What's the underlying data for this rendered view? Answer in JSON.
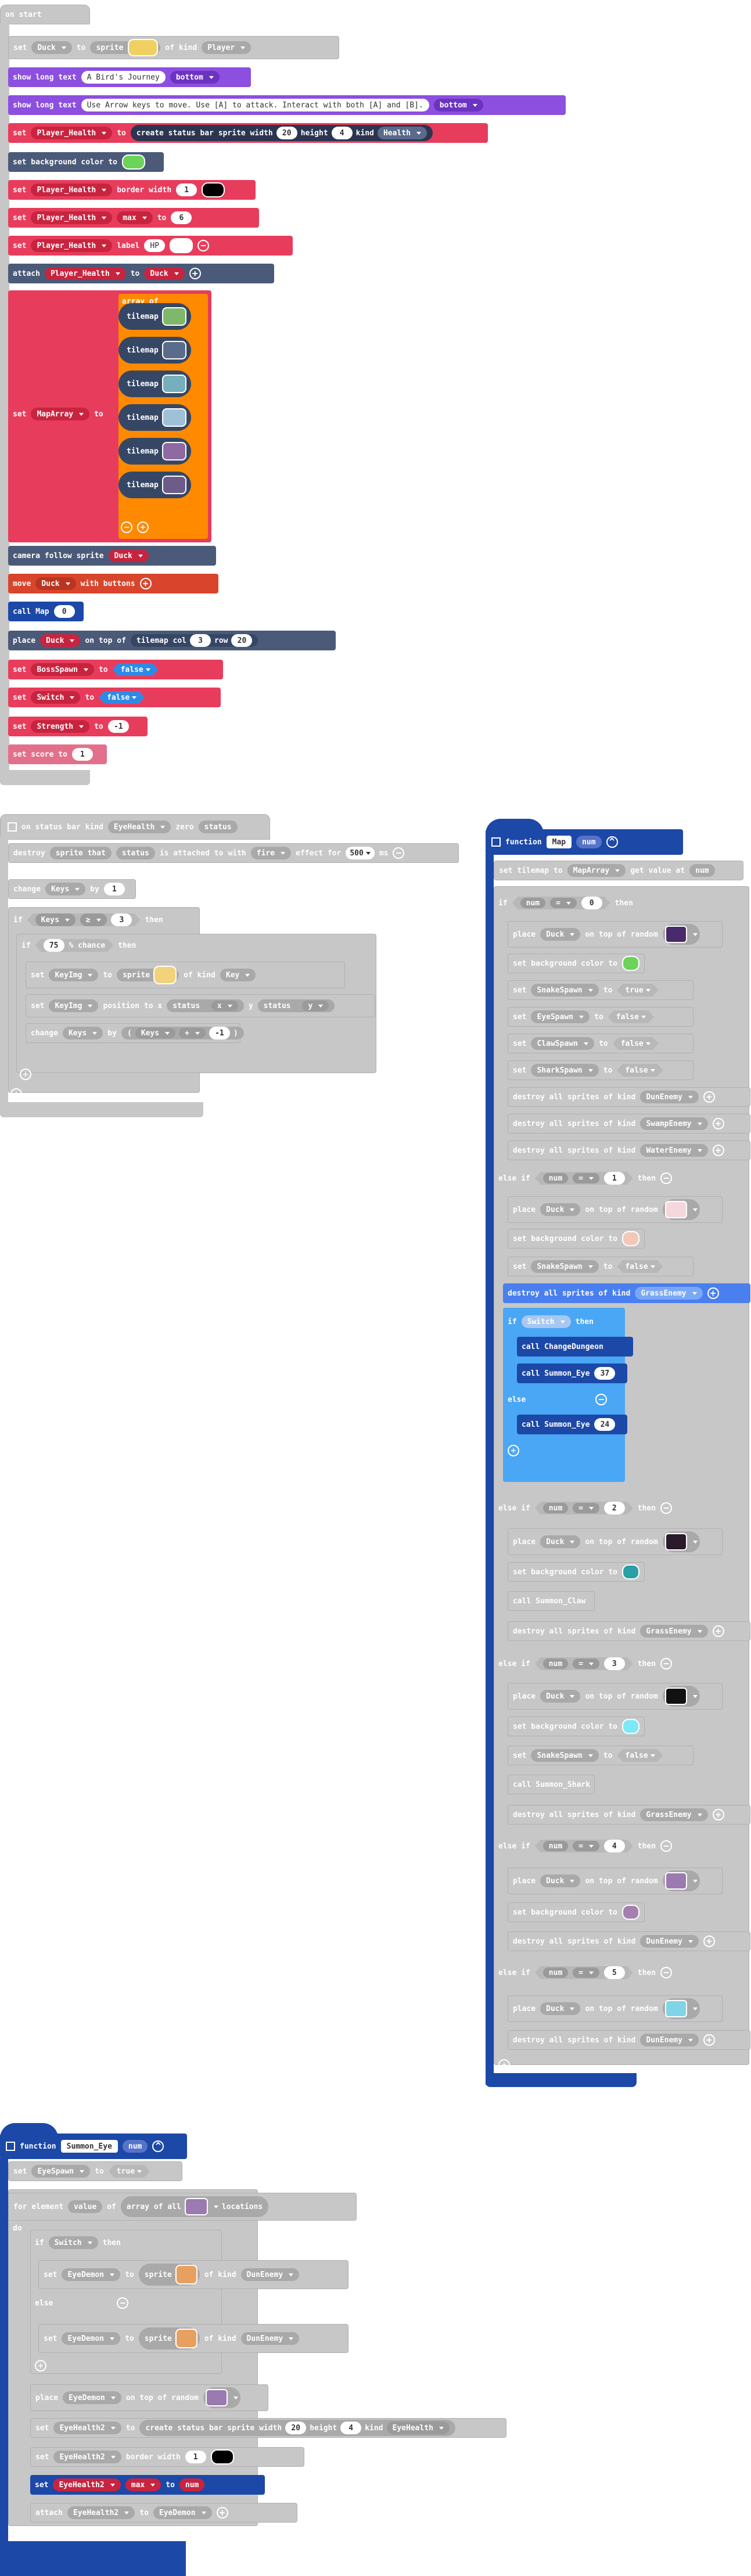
{
  "on_start": {
    "header": "on start",
    "rows": {
      "r1": {
        "set": "set",
        "var": "Duck",
        "to": "to",
        "sprite": "sprite",
        "ofkind": "of kind",
        "kind": "Player"
      },
      "r2": {
        "label": "show long text",
        "text": "A Bird's Journey",
        "pos": "bottom"
      },
      "r3": {
        "label": "show long text",
        "text": "Use Arrow keys to move. Use [A] to attack.  Interact with both [A] and [B].",
        "pos": "bottom"
      },
      "r4": {
        "set": "set",
        "var": "Player_Health",
        "to": "to",
        "create": "create status bar sprite width",
        "width": "20",
        "height_label": "height",
        "height": "4",
        "kind_label": "kind",
        "kind": "Health"
      },
      "r5": {
        "label": "set background color to"
      },
      "r6": {
        "set": "set",
        "var": "Player_Health",
        "prop": "border width",
        "val": "1"
      },
      "r7": {
        "set": "set",
        "var": "Player_Health",
        "prop": "max",
        "to": "to",
        "val": "6"
      },
      "r8": {
        "set": "set",
        "var": "Player_Health",
        "prop": "label",
        "val": "HP"
      },
      "r9": {
        "attach": "attach",
        "var": "Player_Health",
        "to": "to",
        "target": "Duck"
      },
      "r10": {
        "set": "set",
        "var": "MapArray",
        "to": "to",
        "array_of": "array of",
        "tilemap": "tilemap"
      },
      "r11": {
        "label": "camera follow sprite",
        "var": "Duck"
      },
      "r12": {
        "move": "move",
        "var": "Duck",
        "with": "with buttons"
      },
      "r13": {
        "call": "call Map",
        "arg": "0"
      },
      "r14": {
        "place": "place",
        "var": "Duck",
        "ontop": "on top of",
        "tile": "tilemap col",
        "col": "3",
        "row_label": "row",
        "row": "20"
      },
      "r15": {
        "set": "set",
        "var": "BossSpawn",
        "to": "to",
        "val": "false"
      },
      "r16": {
        "set": "set",
        "var": "Switch",
        "to": "to",
        "val": "false"
      },
      "r17": {
        "set": "set",
        "var": "Strength",
        "to": "to",
        "val": "-1"
      },
      "r18": {
        "label": "set score to",
        "val": "1"
      }
    }
  },
  "status_event": {
    "header": "on status bar kind",
    "kind": "EyeHealth",
    "zero": "zero",
    "status": "status",
    "destroy": "destroy",
    "sprite_that": "sprite that",
    "is_attached": "is attached to",
    "with": "with",
    "effect": "fire",
    "effect_for": "effect for",
    "ms": "500",
    "ms_unit": "ms",
    "change_keys": "change",
    "keys": "Keys",
    "by": "by",
    "by_val": "1",
    "if": "if",
    "op": "≥",
    "cmp": "3",
    "then": "then",
    "chance_val": "75",
    "chance": "% chance",
    "then2": "then",
    "set_keyimg": "set",
    "keyimg": "KeyImg",
    "to": "to",
    "sprite": "sprite",
    "ofkind": "of kind",
    "keykind": "Key",
    "set_pos": "set",
    "pos_text": "position to x",
    "x": "x",
    "y_label": "y",
    "y": "y",
    "change2": "change",
    "by2": "by",
    "eq": "+",
    "neg1": "-1"
  },
  "fn_map": {
    "function": "function",
    "name": "Map",
    "param": "num",
    "set_tilemap": "set tilemap to",
    "maparray": "MapArray",
    "get_value": "get value at",
    "num": "num",
    "if": "if",
    "eq": "=",
    "then": "then",
    "else_if": "else if",
    "else": "else",
    "v0": "0",
    "v1": "1",
    "v2": "2",
    "v3": "3",
    "v4": "4",
    "v5": "5",
    "place": "place",
    "duck": "Duck",
    "ontop_random": "on top of random",
    "setbg": "set background color to",
    "set": "set",
    "to": "to",
    "snakespawn": "SnakeSpawn",
    "eyespawn": "EyeSpawn",
    "clawspawn": "ClawSpawn",
    "sharkspawn": "SharkSpawn",
    "true": "true",
    "false": "false",
    "destroy_all": "destroy all sprites of kind",
    "dunenemy": "DunEnemy",
    "swampenemy": "SwampEnemy",
    "waterenemy": "WaterEnemy",
    "grassenemy": "GrassEnemy",
    "switch": "Switch",
    "call_changedungeon": "call ChangeDungeon",
    "call_summon_eye": "call Summon_Eye",
    "eye37": "37",
    "eye24": "24",
    "call_summon_claw": "call Summon_Claw",
    "call_summon_shark": "call Summon_Shark"
  },
  "fn_summon": {
    "function": "function",
    "name": "Summon_Eye",
    "param": "num",
    "set": "set",
    "eyespawn": "EyeSpawn",
    "to": "to",
    "true": "true",
    "for_element": "for element",
    "value": "value",
    "of": "of",
    "array_all": "array of all",
    "locations": "locations",
    "do": "do",
    "if": "if",
    "switch": "Switch",
    "then": "then",
    "else": "else",
    "eyedemon": "EyeDemon",
    "sprite": "sprite",
    "ofkind": "of kind",
    "dunenemy": "DunEnemy",
    "place": "place",
    "ontop_random": "on top of random",
    "eyehealth2": "EyeHealth2",
    "create": "create status bar sprite width",
    "w": "20",
    "height": "height",
    "h": "4",
    "kind": "kind",
    "eyehealth": "EyeHealth",
    "border": "border width",
    "bw": "1",
    "max": "max",
    "num": "num",
    "attach": "attach"
  },
  "colors": {
    "bg_green": "#6cd35a",
    "bg_peach": "#f2c8b8",
    "bg_teal": "#2a9fa6",
    "bg_cyan": "#7ee8f5",
    "bg_mauve": "#a57fb0"
  }
}
